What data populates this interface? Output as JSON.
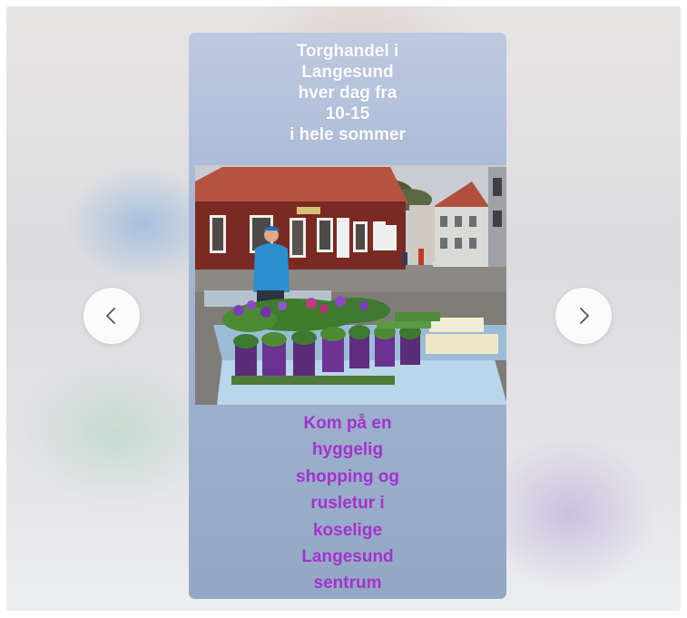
{
  "viewer": {
    "prev_icon": "chevron-left-icon",
    "next_icon": "chevron-right-icon"
  },
  "story": {
    "top_text": "Torghandel i\nLangesund\nhver dag fra\n10-15\ni hele sommer",
    "bottom_text": "Kom på en\nhyggelig\nshopping og\nrusletur i\nkoselige\nLangesund\nsentrum",
    "top_text_color": "#fbfcff",
    "bottom_text_color": "#a531cf"
  }
}
